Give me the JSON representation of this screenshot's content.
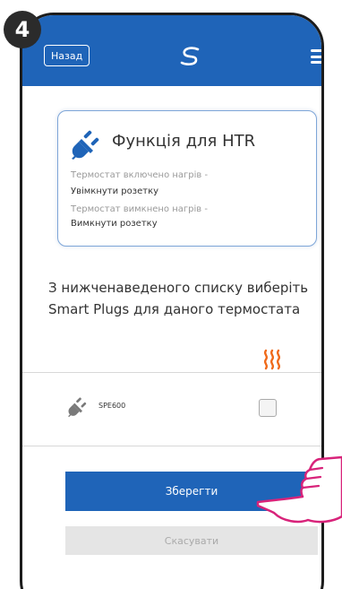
{
  "step_number": "4",
  "header": {
    "back_label": "Назад",
    "logo_icon": "logo-icon",
    "menu_icon": "hamburger-menu-icon",
    "bar_color": "#1f64b8"
  },
  "info_card": {
    "icon": "plug-icon",
    "title": "Функція для HTR",
    "lines": [
      {
        "text": "Термостат включено нагрів -",
        "style": "muted"
      },
      {
        "text": "Увімкнути розетку",
        "style": "dark"
      },
      {
        "text": "Термостат вимкнено нагрів -",
        "style": "muted"
      },
      {
        "text": "Вимкнути розетку",
        "style": "dark"
      }
    ]
  },
  "instruction": "З нижченаведеного списку виберіть Smart Plugs для даного термостата",
  "column_header_icon": "heating-icon",
  "devices": [
    {
      "icon": "plug-icon",
      "name": "SPE600",
      "checked": false
    }
  ],
  "buttons": {
    "save_label": "Зберегти",
    "cancel_label": "Скасувати"
  },
  "colors": {
    "accent": "#1f64b8",
    "heat": "#f06a1a",
    "hand_outline": "#d8237a"
  }
}
